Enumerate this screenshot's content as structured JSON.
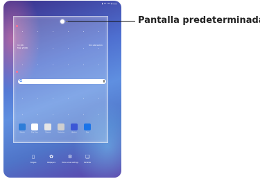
{
  "callout": {
    "label": "Pantalla predeterminada"
  },
  "status": {
    "text": "▮ 11:44 ▮ ▯▯▯"
  },
  "widget": {
    "time": "11:44",
    "date": "Mié 15/06",
    "weather": "Sin ubicación"
  },
  "search": {
    "logo": "G"
  },
  "apps": [
    {
      "name": "Galería",
      "color": "#2e7dd8",
      "icon": "gallery-icon"
    },
    {
      "name": "Play Store",
      "color": "#ffffff",
      "icon": "play-store-icon"
    },
    {
      "name": "Cámara",
      "color": "#e6e6e6",
      "icon": "camera-icon"
    },
    {
      "name": "Contactos",
      "color": "#cfcfcf",
      "icon": "contacts-icon"
    },
    {
      "name": "Ajustes",
      "color": "#3b57d6",
      "icon": "settings-icon"
    },
    {
      "name": "Duo",
      "color": "#1a73e8",
      "icon": "video-icon"
    }
  ],
  "dock": [
    {
      "label": "Widgets",
      "icon": "widgets-icon",
      "glyph": "▯"
    },
    {
      "label": "Wallpapers",
      "icon": "wallpaper-icon",
      "glyph": "✿"
    },
    {
      "label": "Home screen settings",
      "icon": "settings-gear-icon",
      "glyph": "⚙"
    },
    {
      "label": "Pantallas",
      "icon": "pages-icon",
      "glyph": "❏"
    }
  ]
}
